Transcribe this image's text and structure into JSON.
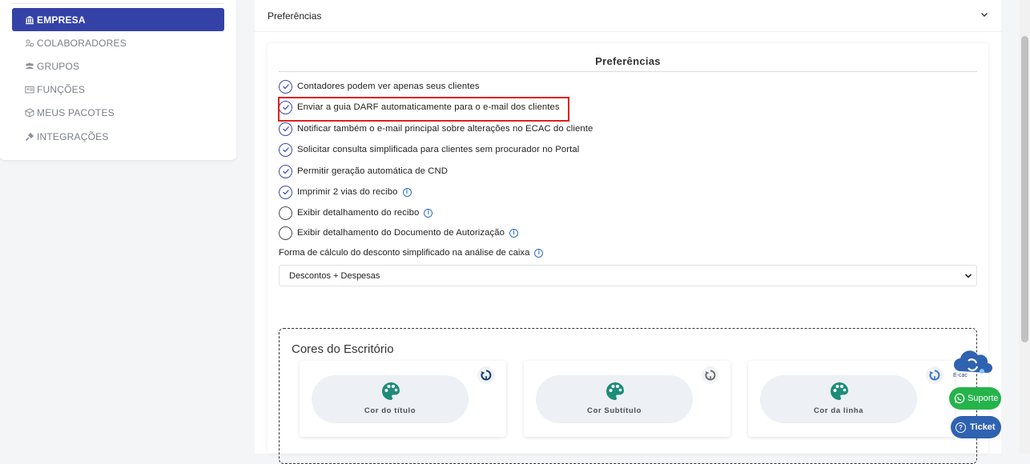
{
  "sidebar": {
    "items": [
      {
        "label": "EMPRESA",
        "icon": "bank-icon",
        "active": true
      },
      {
        "label": "COLABORADORES",
        "icon": "users-cog-icon",
        "active": false
      },
      {
        "label": "GRUPOS",
        "icon": "users-icon",
        "active": false
      },
      {
        "label": "FUNÇÕES",
        "icon": "id-card-icon",
        "active": false
      },
      {
        "label": "MEUS PACOTES",
        "icon": "box-icon",
        "active": false
      },
      {
        "label": "INTEGRAÇÕES",
        "icon": "plug-icon",
        "active": false
      }
    ]
  },
  "accordion": {
    "title": "Preferências"
  },
  "panel": {
    "title": "Preferências",
    "options": [
      {
        "label": "Contadores podem ver apenas seus clientes",
        "checked": true,
        "info": false
      },
      {
        "label": "Enviar a guia DARF automaticamente para o e-mail dos clientes",
        "checked": true,
        "info": false
      },
      {
        "label": "Notificar também o e-mail principal sobre alterações no ECAC do cliente",
        "checked": true,
        "info": false
      },
      {
        "label": "Solicitar consulta simplificada para clientes sem procurador no Portal",
        "checked": true,
        "info": false
      },
      {
        "label": "Permitir geração automática de CND",
        "checked": true,
        "info": false
      },
      {
        "label": "Imprimir 2 vias do recibo",
        "checked": true,
        "info": true
      },
      {
        "label": "Exibir detalhamento do recibo",
        "checked": false,
        "info": true
      },
      {
        "label": "Exibir detalhamento do Documento de Autorização",
        "checked": false,
        "info": true
      }
    ],
    "calc_label": "Forma de cálculo do desconto simplificado na análise de caixa",
    "calc_value": "Descontos + Despesas"
  },
  "colors": {
    "title": "Cores do Escritório",
    "cards": [
      {
        "label": "Cor do título",
        "reset_color": "#1a3d7a"
      },
      {
        "label": "Cor Subtítulo",
        "reset_color": "#6b6f75"
      },
      {
        "label": "Cor da linha",
        "reset_color": "#3b78c6"
      }
    ],
    "palette_color": "#1e8c7a"
  },
  "floating": {
    "ecac_label": "E-cac",
    "suporte_label": "Suporte",
    "ticket_label": "Ticket"
  },
  "theme": {
    "accent": "#3442a8",
    "highlight": "#e02020",
    "whatsapp": "#25b34b",
    "ticket": "#2f62b0"
  }
}
